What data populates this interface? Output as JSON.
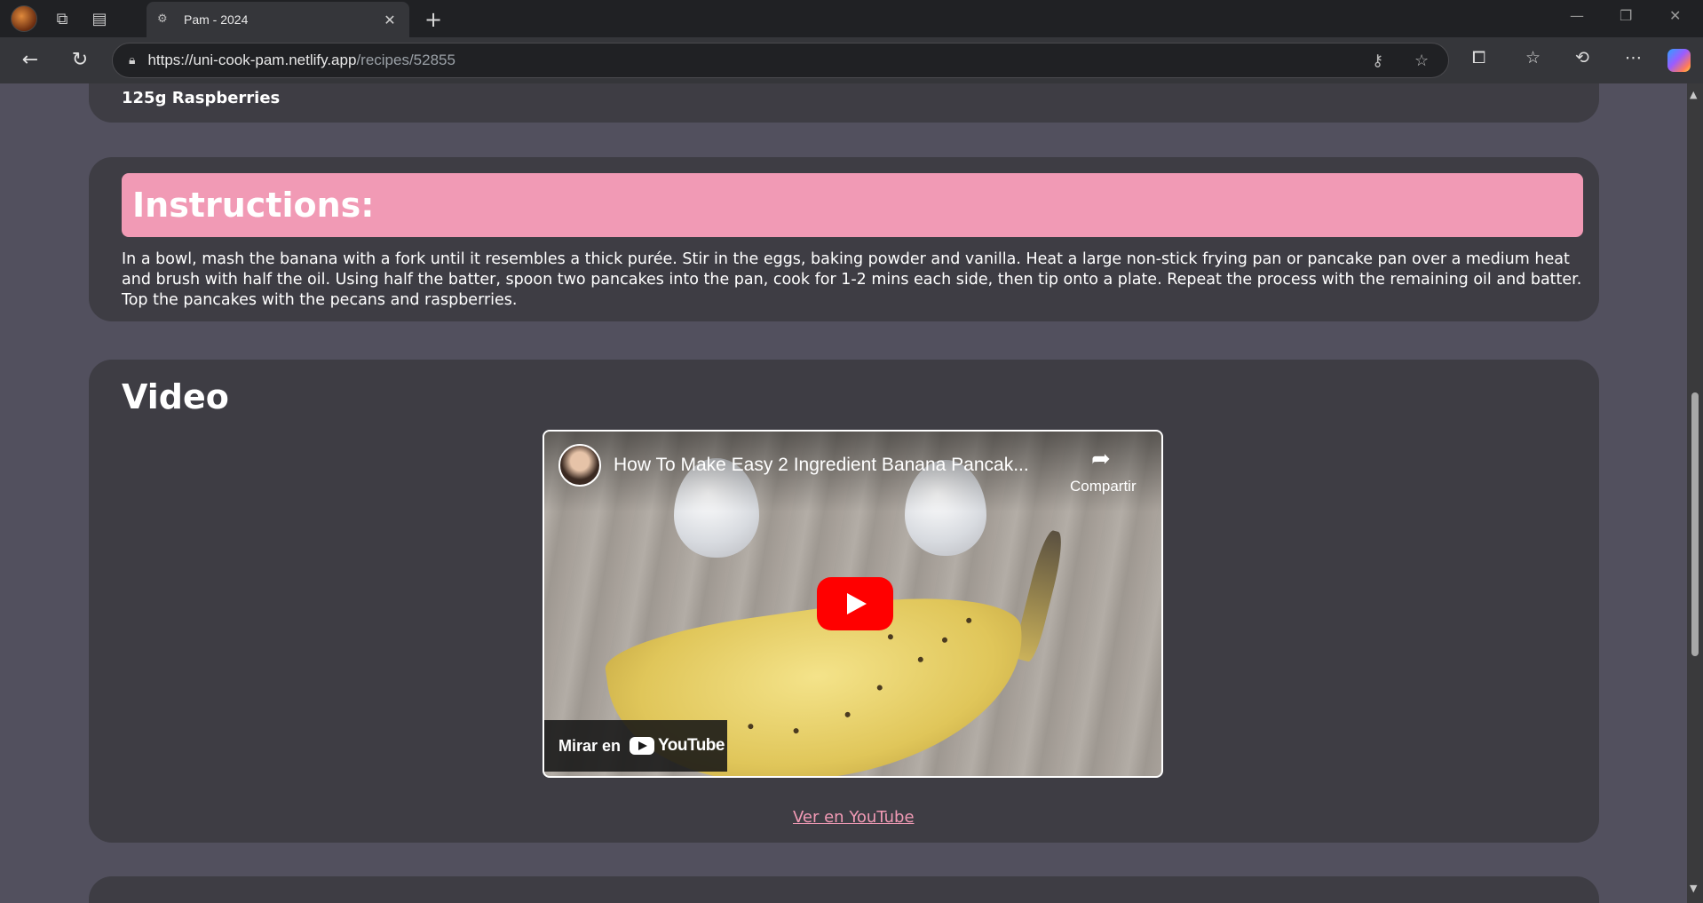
{
  "browser": {
    "tab_title": "Pam - 2024",
    "tab_close": "✕",
    "new_tab": "+",
    "url_host": "https://uni-cook-pam.netlify.app",
    "url_path": "/recipes/52855",
    "window_controls": {
      "minimize": "—",
      "restore": "❐",
      "close": "✕"
    },
    "icons": [
      "profile-avatar",
      "workspaces-icon",
      "vertical-tabs-icon",
      "back-icon",
      "refresh-icon",
      "lock-icon",
      "key-icon",
      "favorite-star-icon",
      "extensions-icon",
      "favorites-icon",
      "history-icon",
      "more-icon",
      "copilot-icon"
    ]
  },
  "recipe": {
    "ingredient_last": "125g Raspberries",
    "instructions_heading": "Instructions:",
    "instructions_text": "In a bowl, mash the banana with a fork until it resembles a thick purée. Stir in the eggs, baking powder and vanilla. Heat a large non-stick frying pan or pancake pan over a medium heat and brush with half the oil. Using half the batter, spoon two pancakes into the pan, cook for 1-2 mins each side, then tip onto a plate. Repeat the process with the remaining oil and batter. Top the pancakes with the pecans and raspberries.",
    "video_heading": "Video",
    "video": {
      "title": "How To Make Easy 2 Ingredient Banana Pancak...",
      "share_label": "Compartir",
      "watch_on_label": "Mirar en",
      "logo_text": "YouTube"
    },
    "youtube_link": "Ver en YouTube"
  },
  "colors": {
    "page_bg": "#52505e",
    "card_bg": "#3e3d44",
    "accent_pink": "#f19ab5",
    "youtube_red": "#ff0000"
  }
}
